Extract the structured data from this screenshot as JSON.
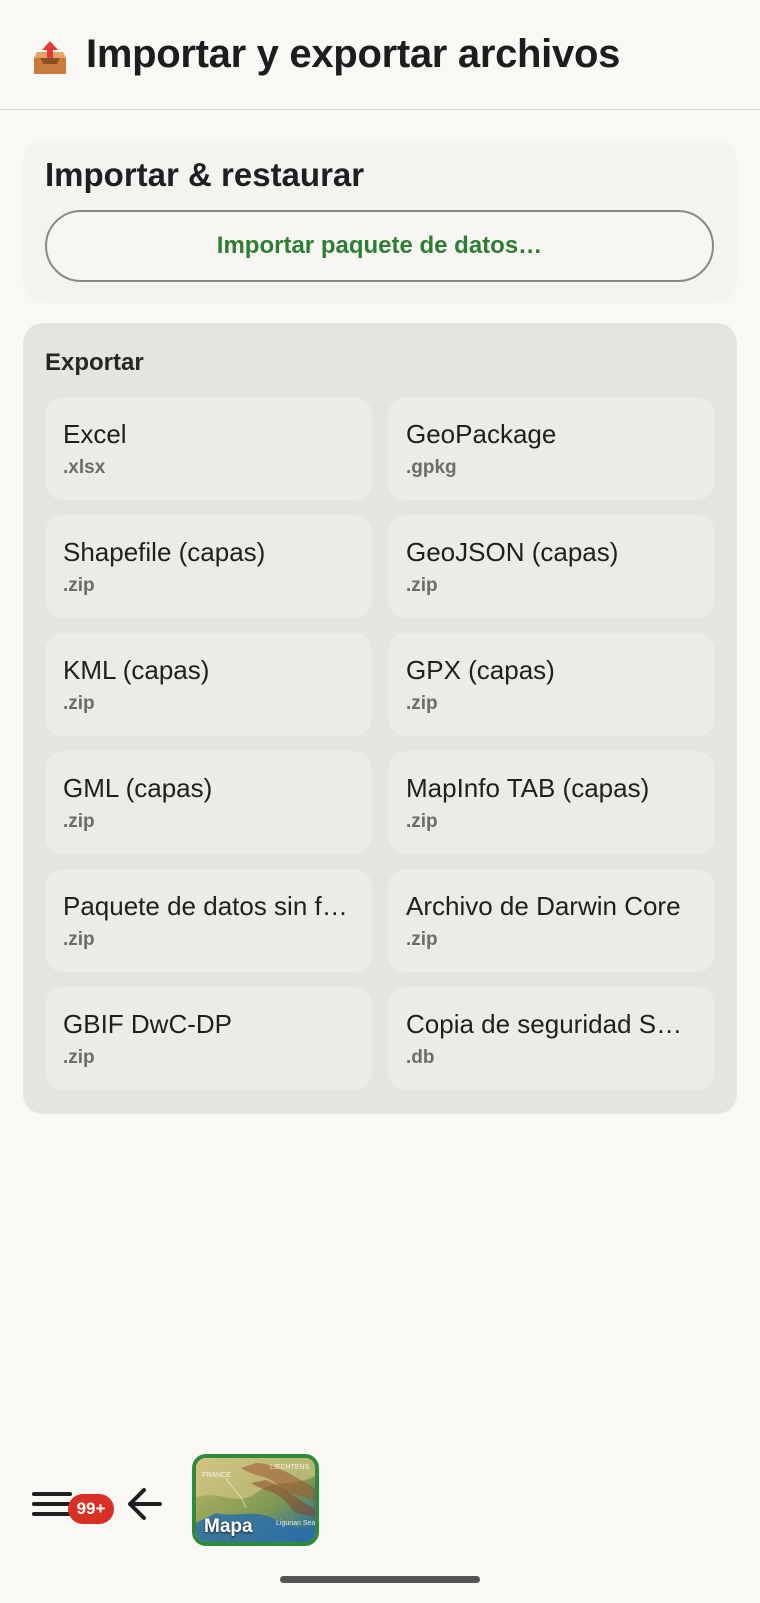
{
  "header": {
    "icon": "outbox-tray-icon",
    "title": "Importar y exportar archivos"
  },
  "import_section": {
    "title": "Importar & restaurar",
    "button_label": "Importar paquete de datos…"
  },
  "export_section": {
    "title": "Exportar",
    "items": [
      {
        "name": "Excel",
        "ext": ".xlsx"
      },
      {
        "name": "GeoPackage",
        "ext": ".gpkg"
      },
      {
        "name": "Shapefile (capas)",
        "ext": ".zip"
      },
      {
        "name": "GeoJSON (capas)",
        "ext": ".zip"
      },
      {
        "name": "KML (capas)",
        "ext": ".zip"
      },
      {
        "name": "GPX (capas)",
        "ext": ".zip"
      },
      {
        "name": "GML (capas)",
        "ext": ".zip"
      },
      {
        "name": "MapInfo TAB (capas)",
        "ext": ".zip"
      },
      {
        "name": "Paquete de datos sin fr…",
        "ext": ".zip"
      },
      {
        "name": "Archivo de Darwin Core",
        "ext": ".zip"
      },
      {
        "name": "GBIF DwC-DP",
        "ext": ".zip"
      },
      {
        "name": "Copia de seguridad SQ…",
        "ext": ".db"
      }
    ]
  },
  "bottom_bar": {
    "menu_icon": "hamburger-menu-icon",
    "notification_badge": "99+",
    "back_icon": "arrow-left-icon",
    "map_thumbnail_label": "Mapa",
    "map_thumbnail_texts": [
      "FRANCE",
      "LIECHTENS",
      "Ligurian Sea"
    ]
  },
  "colors": {
    "accent_green": "#2e7d32",
    "badge_red": "#d93025",
    "page_background": "#f9f8f5",
    "export_card_background": "#e6e4de"
  }
}
